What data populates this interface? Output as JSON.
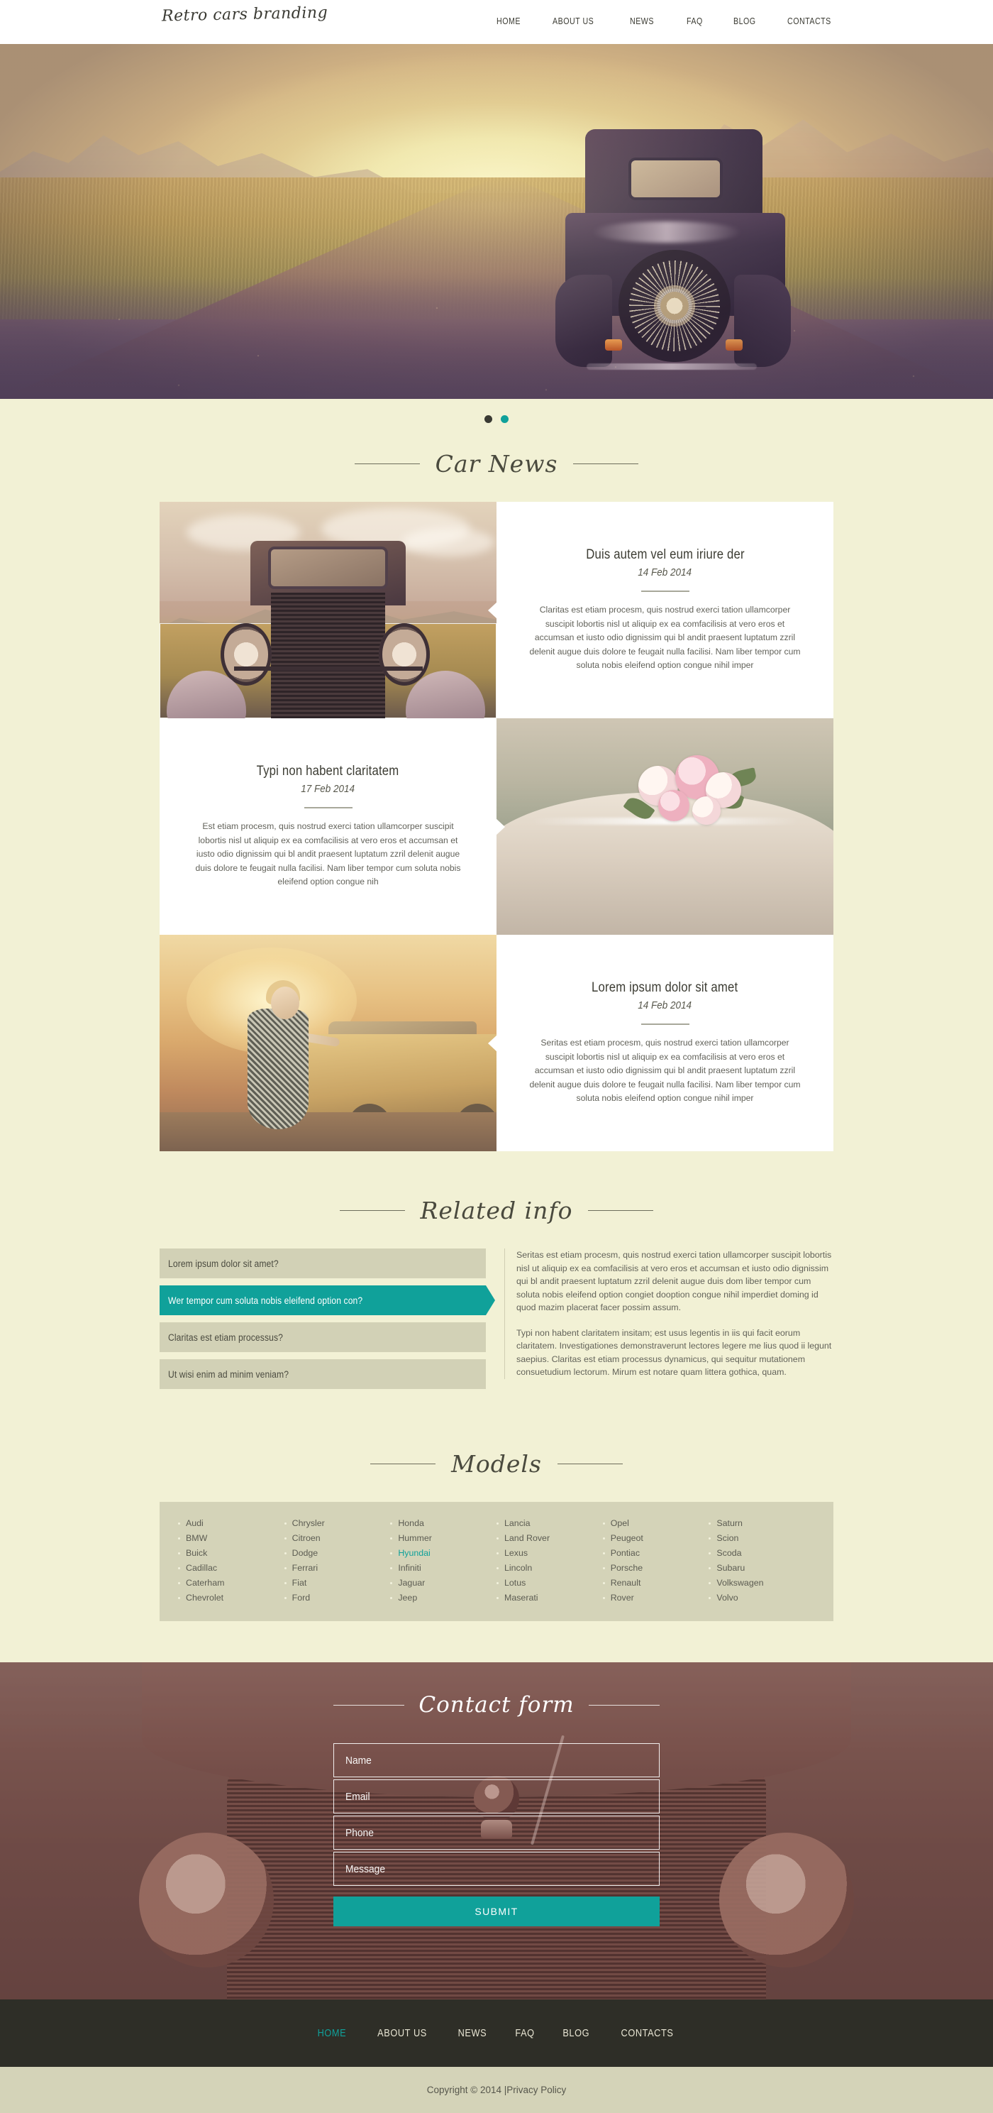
{
  "header": {
    "logo": "Retro cars branding",
    "nav": [
      {
        "label": "HOME"
      },
      {
        "label": "ABOUT US"
      },
      {
        "label": "NEWS"
      },
      {
        "label": "FAQ"
      },
      {
        "label": "BLOG"
      },
      {
        "label": "CONTACTS"
      }
    ]
  },
  "hero": {
    "slider_dots": [
      {
        "state": "inactive"
      },
      {
        "state": "active"
      }
    ]
  },
  "sections": {
    "news_title": "Car News",
    "related_title": "Related info",
    "models_title": "Models",
    "contact_title": "Contact form"
  },
  "news": [
    {
      "title": "Duis autem vel eum iriure der",
      "date": "14 Feb 2014",
      "body": "Claritas est etiam procesm, quis nostrud exerci tation ullamcorper suscipit lobortis nisl ut aliquip ex ea comfacilisis at vero eros et accumsan et iusto odio dignissim qui bl andit praesent luptatum zzril delenit augue duis dolore te feugait nulla facilisi. Nam liber tempor cum soluta nobis eleifend option congue nihil imper",
      "image_alt": "vintage-car-front-grille-photo",
      "layout": "image-left"
    },
    {
      "title": "Typi non habent claritatem",
      "date": "17 Feb 2014",
      "body": "Est etiam procesm, quis nostrud exerci tation ullamcorper suscipit lobortis nisl ut aliquip ex ea comfacilisis at vero eros et accumsan et iusto odio dignissim qui bl andit praesent luptatum zzril delenit augue duis dolore te feugait nulla facilisi. Nam liber tempor cum soluta nobis eleifend option congue nih",
      "image_alt": "wedding-car-with-roses-photo",
      "layout": "image-right"
    },
    {
      "title": "Lorem ipsum dolor sit amet",
      "date": "14 Feb 2014",
      "body": "Seritas est etiam procesm, quis nostrud exerci tation ullamcorper suscipit lobortis nisl ut aliquip ex ea comfacilisis at vero eros et accumsan et iusto odio dignissim qui bl andit praesent luptatum zzril delenit augue duis dolore te feugait nulla facilisi. Nam liber tempor cum soluta nobis eleifend option congue nihil imper",
      "image_alt": "retro-lady-beside-yellow-car-photo",
      "layout": "image-left"
    }
  ],
  "related": {
    "accordion": [
      {
        "label": "Lorem ipsum dolor sit amet?",
        "active": false
      },
      {
        "label": "Wer tempor cum soluta nobis eleifend option con?",
        "active": true
      },
      {
        "label": "Claritas est etiam processus?",
        "active": false
      },
      {
        "label": "Ut wisi enim ad minim veniam?",
        "active": false
      }
    ],
    "paragraphs": [
      "Seritas est etiam procesm, quis nostrud exerci tation ullamcorper suscipit lobortis nisl ut aliquip ex ea comfacilisis at vero eros et accumsan et iusto odio dignissim qui bl andit praesent luptatum zzril delenit augue duis dom liber tempor cum soluta nobis eleifend option congiet dooption congue nihil imperdiet doming id quod mazim placerat facer possim assum.",
      "Typi non habent claritatem insitam; est usus legentis in iis qui facit eorum claritatem. Investigationes demonstraverunt lectores legere me lius quod ii legunt saepius. Claritas est etiam processus dynamicus, qui sequitur mutationem consuetudium lectorum. Mirum est notare quam littera gothica, quam."
    ]
  },
  "models": {
    "columns": [
      {
        "items": [
          {
            "name": "Audi",
            "active": false
          },
          {
            "name": "BMW",
            "active": false
          },
          {
            "name": "Buick",
            "active": false
          },
          {
            "name": "Cadillac",
            "active": false
          },
          {
            "name": "Caterham",
            "active": false
          },
          {
            "name": "Chevrolet",
            "active": false
          }
        ]
      },
      {
        "items": [
          {
            "name": "Chrysler",
            "active": false
          },
          {
            "name": "Citroen",
            "active": false
          },
          {
            "name": "Dodge",
            "active": false
          },
          {
            "name": "Ferrari",
            "active": false
          },
          {
            "name": "Fiat",
            "active": false
          },
          {
            "name": "Ford",
            "active": false
          }
        ]
      },
      {
        "items": [
          {
            "name": "Honda",
            "active": false
          },
          {
            "name": "Hummer",
            "active": false
          },
          {
            "name": "Hyundai",
            "active": true
          },
          {
            "name": "Infiniti",
            "active": false
          },
          {
            "name": "Jaguar",
            "active": false
          },
          {
            "name": "Jeep",
            "active": false
          }
        ]
      },
      {
        "items": [
          {
            "name": "Lancia",
            "active": false
          },
          {
            "name": "Land Rover",
            "active": false
          },
          {
            "name": "Lexus",
            "active": false
          },
          {
            "name": "Lincoln",
            "active": false
          },
          {
            "name": "Lotus",
            "active": false
          },
          {
            "name": "Maserati",
            "active": false
          }
        ]
      },
      {
        "items": [
          {
            "name": "Opel",
            "active": false
          },
          {
            "name": "Peugeot",
            "active": false
          },
          {
            "name": "Pontiac",
            "active": false
          },
          {
            "name": "Porsche",
            "active": false
          },
          {
            "name": "Renault",
            "active": false
          },
          {
            "name": "Rover",
            "active": false
          }
        ]
      },
      {
        "items": [
          {
            "name": "Saturn",
            "active": false
          },
          {
            "name": "Scion",
            "active": false
          },
          {
            "name": "Scoda",
            "active": false
          },
          {
            "name": "Subaru",
            "active": false
          },
          {
            "name": "Volkswagen",
            "active": false
          },
          {
            "name": "Volvo",
            "active": false
          }
        ]
      }
    ]
  },
  "contact_form": {
    "fields": [
      {
        "name": "name",
        "placeholder": "Name",
        "value": ""
      },
      {
        "name": "email",
        "placeholder": "Email",
        "value": ""
      },
      {
        "name": "phone",
        "placeholder": "Phone",
        "value": ""
      },
      {
        "name": "message",
        "placeholder": "Message",
        "value": ""
      }
    ],
    "submit_label": "SUBMIT"
  },
  "footer": {
    "nav": [
      {
        "label": "HOME",
        "active": true
      },
      {
        "label": "ABOUT US",
        "active": false
      },
      {
        "label": "NEWS",
        "active": false
      },
      {
        "label": "FAQ",
        "active": false
      },
      {
        "label": "BLOG",
        "active": false
      },
      {
        "label": "CONTACTS",
        "active": false
      }
    ],
    "copyright": "Copyright © 2014 | ",
    "privacy": "Privacy Policy"
  },
  "colors": {
    "accent": "#10a19a",
    "page_bg": "#f2f1d5",
    "panel_bg": "#d4d3b8",
    "footer_bg": "#2e2e27",
    "text": "#5c5c52"
  }
}
